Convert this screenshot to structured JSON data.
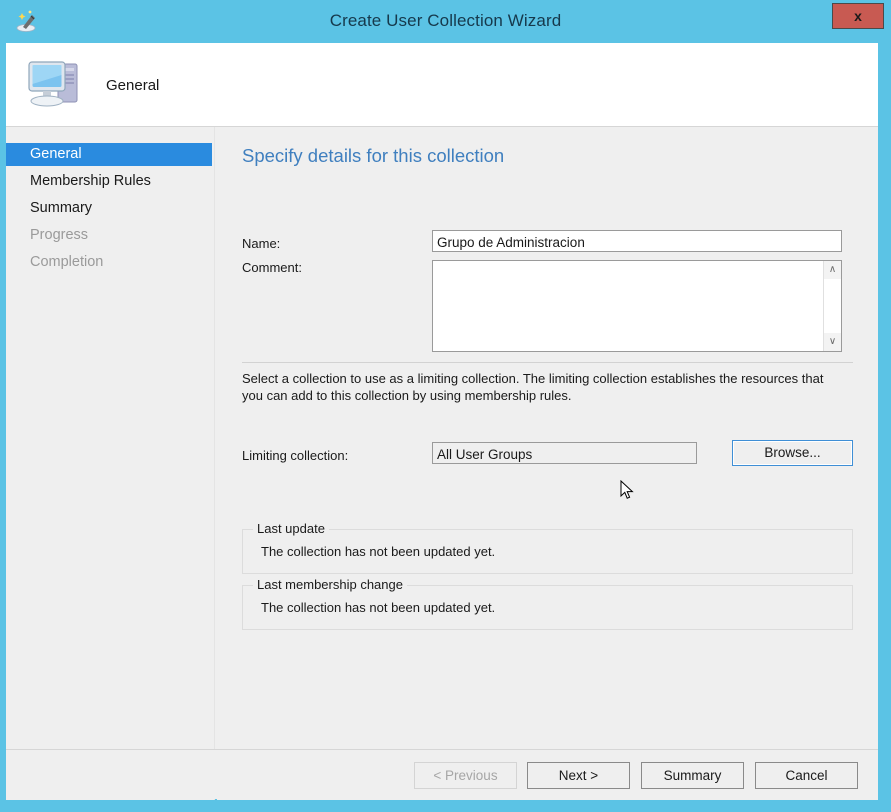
{
  "window": {
    "title": "Create User Collection Wizard",
    "close_label": "x",
    "titlebar_color": "#5bc3e5",
    "close_button_color": "#c85a52",
    "wizard_icon": "magic-wand-icon"
  },
  "header": {
    "label": "General",
    "icon": "computer-icon"
  },
  "sidebar": {
    "items": [
      {
        "label": "General",
        "state": "selected"
      },
      {
        "label": "Membership Rules",
        "state": "enabled"
      },
      {
        "label": "Summary",
        "state": "enabled"
      },
      {
        "label": "Progress",
        "state": "disabled"
      },
      {
        "label": "Completion",
        "state": "disabled"
      }
    ],
    "selected_color": "#2a8bdf"
  },
  "content": {
    "heading": "Specify details for this collection",
    "heading_color": "#3f7fbf",
    "name_label": "Name:",
    "name_value": "Grupo de Administracion",
    "name_placeholder": "",
    "comment_label": "Comment:",
    "comment_value": "",
    "comment_placeholder": "",
    "scrollbar": {
      "up_icon": "chevron-up-icon",
      "up_glyph": "∧",
      "down_icon": "chevron-down-icon",
      "down_glyph": "∨"
    },
    "description": "Select a collection to use as a limiting collection. The limiting collection establishes the resources that you can add to this collection by using membership rules.",
    "limiting_label": "Limiting collection:",
    "limiting_value": "All User Groups",
    "browse_label": "Browse...",
    "groups": [
      {
        "legend": "Last update",
        "text": "The collection has not been updated yet."
      },
      {
        "legend": "Last membership change",
        "text": "The collection has not been updated yet."
      }
    ]
  },
  "footer": {
    "previous_label": "< Previous",
    "next_label": "Next >",
    "summary_label": "Summary",
    "cancel_label": "Cancel"
  }
}
